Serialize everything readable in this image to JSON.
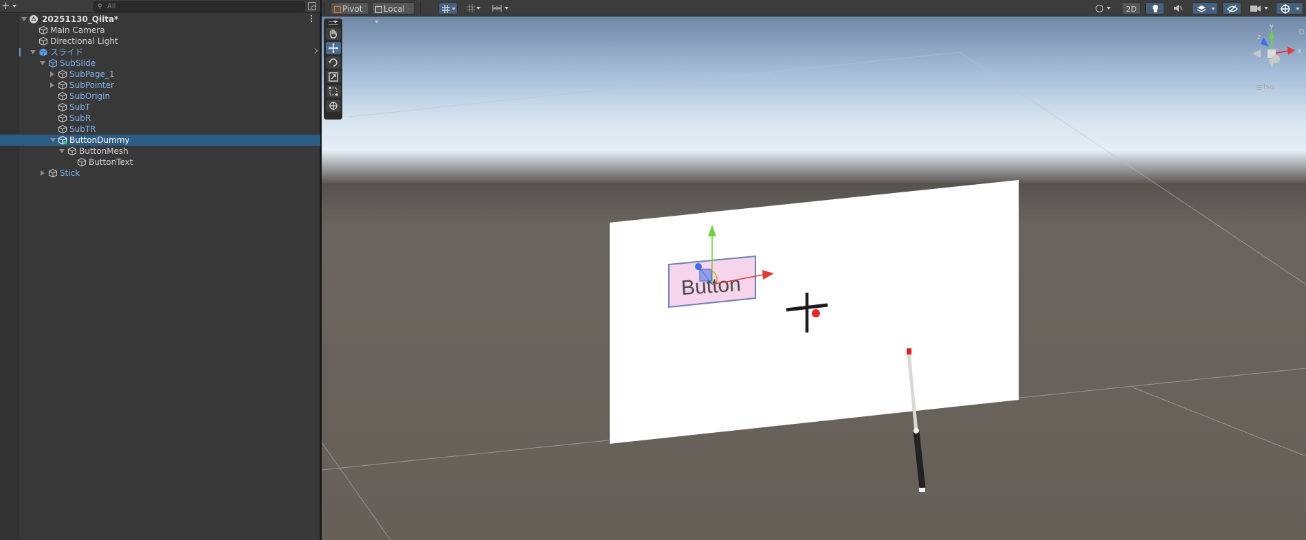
{
  "hierarchy": {
    "add_label": "+",
    "search_placeholder": "All",
    "scene_name": "20251130_Qiita*",
    "items": [
      {
        "label": "Main Camera"
      },
      {
        "label": "Directional Light"
      },
      {
        "label": "スライド"
      },
      {
        "label": "SubSlide"
      },
      {
        "label": "SubPage_1"
      },
      {
        "label": "SubPointer"
      },
      {
        "label": "SubOrigin"
      },
      {
        "label": "SubT"
      },
      {
        "label": "SubR"
      },
      {
        "label": "SubTR"
      },
      {
        "label": "ButtonDummy"
      },
      {
        "label": "ButtonMesh"
      },
      {
        "label": "ButtonText"
      },
      {
        "label": "Stick"
      }
    ],
    "selected": "ButtonDummy"
  },
  "scene_toolbar": {
    "pivot_label": "Pivot",
    "local_label": "Local",
    "mode_2d_label": "2D"
  },
  "scene": {
    "button_text": "Button",
    "gizmo": {
      "x_label": "x",
      "y_label": "y",
      "z_label": "z",
      "projection_label": "Iso"
    }
  },
  "colors": {
    "selection": "#2c5d87",
    "prefab_blue": "#7fb4ee",
    "x_axis": "#e03a3a",
    "y_axis": "#6fd24a",
    "z_axis": "#3c6fe8"
  },
  "icons": [
    "plus-icon",
    "search-icon",
    "lock-icon",
    "unity-scene-icon",
    "cube-icon",
    "prefab-icon",
    "hand-tool-icon",
    "move-tool-icon",
    "rotate-tool-icon",
    "scale-tool-icon",
    "rect-tool-icon",
    "transform-tool-icon",
    "lighting-icon",
    "audio-icon",
    "effects-icon",
    "visibility-icon",
    "camera-icon",
    "gizmos-icon"
  ]
}
